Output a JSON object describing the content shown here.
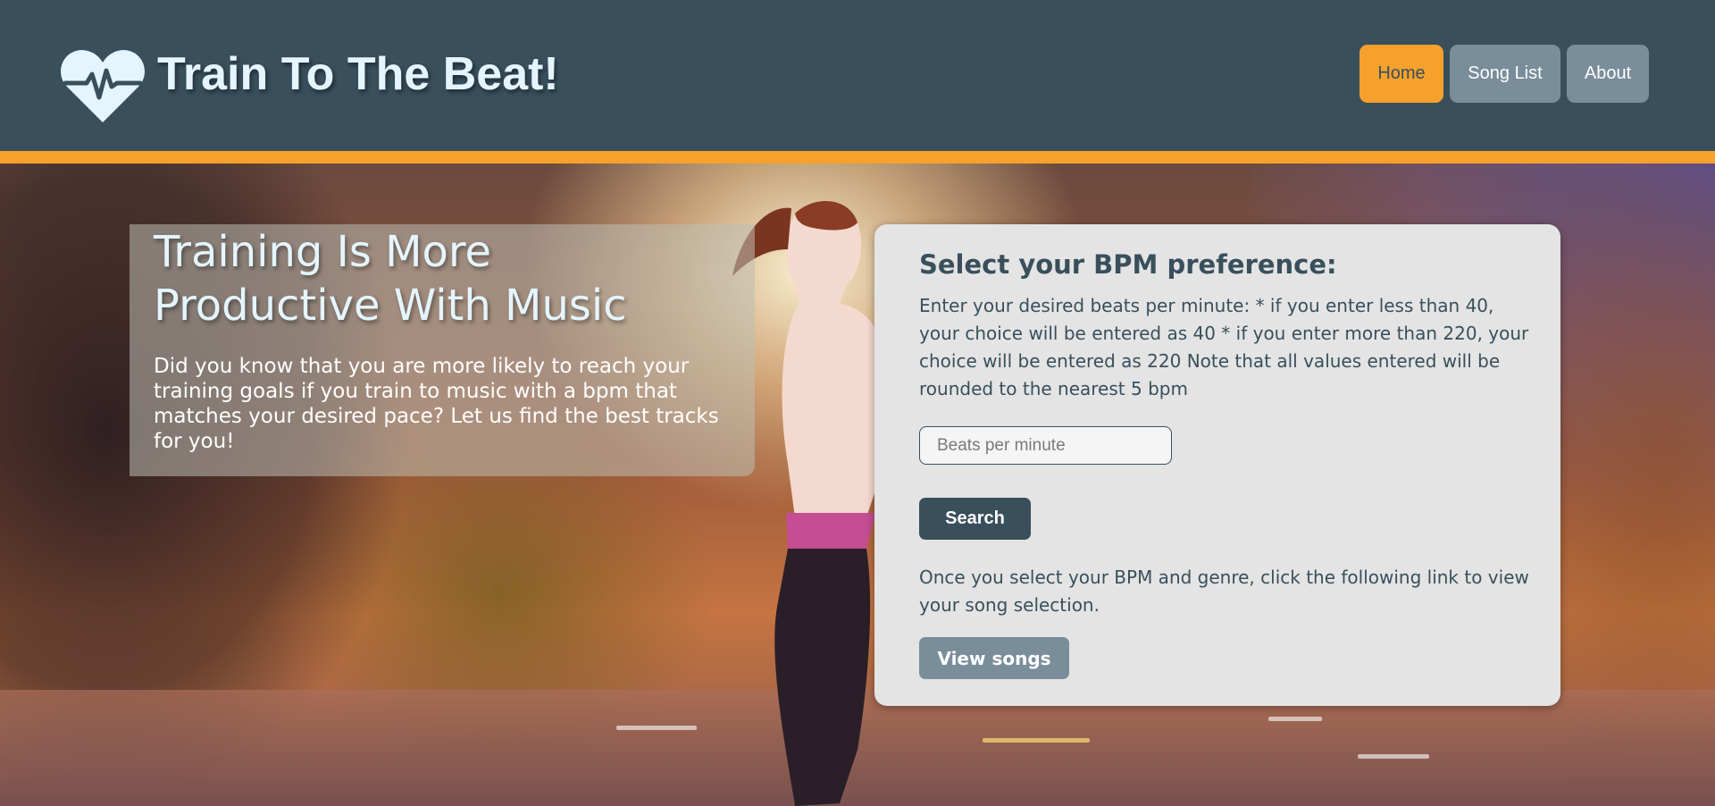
{
  "header": {
    "title": "Train To The Beat!",
    "logo_icon": "heart-pulse-icon"
  },
  "nav": {
    "items": [
      {
        "label": "Home",
        "active": true
      },
      {
        "label": "Song List",
        "active": false
      },
      {
        "label": "About",
        "active": false
      }
    ]
  },
  "intro": {
    "title": "Training Is More Productive With Music",
    "text": "Did you know that you are more likely to reach your training goals if you train to music with a bpm that matches your desired pace? Let us find the best tracks for you!"
  },
  "panel": {
    "title": "Select your BPM preference:",
    "description": "Enter your desired beats per minute: * if you enter less than 40, your choice will be entered as 40 * if you enter more than 220, your choice will be entered as 220 Note that all values entered will be rounded to the nearest 5 bpm",
    "input_placeholder": "Beats per minute",
    "input_value": "",
    "search_label": "Search",
    "note": "Once you select your BPM and genre, click the following link to view your song selection.",
    "view_label": "View songs"
  },
  "colors": {
    "primary": "#394f5c",
    "accent": "#f7a12d",
    "secondary": "#7a8d9a",
    "title_text": "#e4f5ff",
    "panel_bg": "#e4e4e4"
  }
}
